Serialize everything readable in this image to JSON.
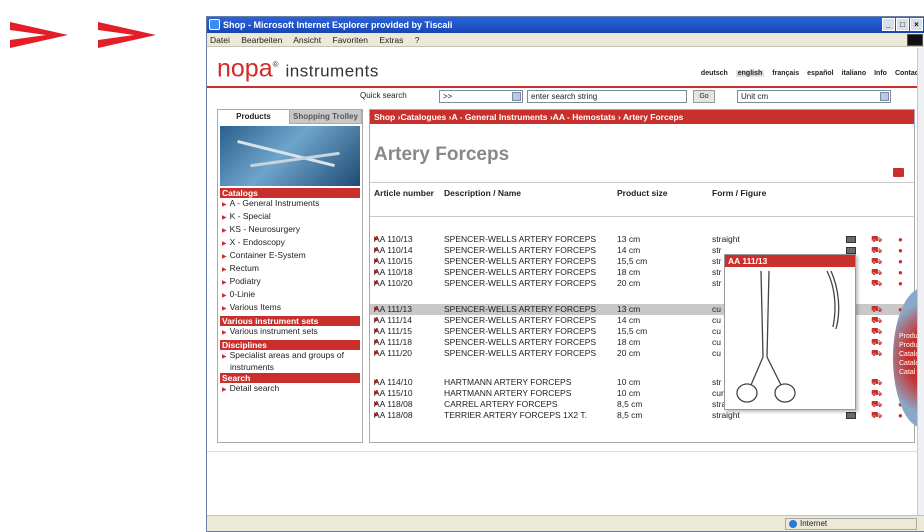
{
  "window": {
    "title": "Shop - Microsoft Internet Explorer provided by Tiscali",
    "controls": [
      "_",
      "□",
      "×"
    ]
  },
  "menubar": [
    "Datei",
    "Bearbeiten",
    "Ansicht",
    "Favoriten",
    "Extras",
    "?"
  ],
  "logo": {
    "brand": "nopa",
    "mark": "®",
    "sub": "instruments"
  },
  "languages": [
    "deutsch",
    "english",
    "français",
    "español",
    "italiano",
    "Info",
    "Contact"
  ],
  "active_language": "english",
  "search": {
    "label": "Quick search",
    "select": ">>",
    "input_value": "enter search string",
    "go": "Go",
    "unit": "Unit cm"
  },
  "sidebar": {
    "tabs": [
      "Products",
      "Shopping Trolley"
    ],
    "sections": [
      {
        "title": "Catalogs",
        "items": [
          "A - General Instruments",
          "K - Special",
          "KS - Neurosurgery",
          "X - Endoscopy",
          "Container E-System",
          "Rectum",
          "Podiatry",
          "0-Linie",
          "Various Items"
        ]
      },
      {
        "title": "Various instrument sets",
        "items": [
          "Various instrument sets"
        ]
      },
      {
        "title": "Disciplines",
        "items": [
          "Specialist areas and groups of instruments"
        ]
      },
      {
        "title": "Search",
        "items": [
          "Detail search"
        ]
      }
    ]
  },
  "breadcrumb": "Shop ›Catalogues ›A - General Instruments ›AA - Hemostats › Artery Forceps",
  "page_title": "Artery Forceps",
  "columns": {
    "article": "Article number",
    "desc": "Description / Name",
    "size": "Product size",
    "form": "Form / Figure"
  },
  "products": [
    {
      "article": "AA 110/13",
      "desc": "SPENCER-WELLS ARTERY FORCEPS",
      "size": "13 cm",
      "form": "straight"
    },
    {
      "article": "AA 110/14",
      "desc": "SPENCER-WELLS ARTERY FORCEPS",
      "size": "14 cm",
      "form": "str"
    },
    {
      "article": "AA 110/15",
      "desc": "SPENCER-WELLS ARTERY FORCEPS",
      "size": "15,5 cm",
      "form": "str"
    },
    {
      "article": "AA 110/18",
      "desc": "SPENCER-WELLS ARTERY FORCEPS",
      "size": "18 cm",
      "form": "str"
    },
    {
      "article": "AA 110/20",
      "desc": "SPENCER-WELLS ARTERY FORCEPS",
      "size": "20 cm",
      "form": "str"
    },
    {
      "article": "AA 111/13",
      "desc": "SPENCER-WELLS ARTERY FORCEPS",
      "size": "13 cm",
      "form": "cu"
    },
    {
      "article": "AA 111/14",
      "desc": "SPENCER-WELLS ARTERY FORCEPS",
      "size": "14 cm",
      "form": "cu"
    },
    {
      "article": "AA 111/15",
      "desc": "SPENCER-WELLS ARTERY FORCEPS",
      "size": "15,5 cm",
      "form": "cu"
    },
    {
      "article": "AA 111/18",
      "desc": "SPENCER-WELLS ARTERY FORCEPS",
      "size": "18 cm",
      "form": "cu"
    },
    {
      "article": "AA 111/20",
      "desc": "SPENCER-WELLS ARTERY FORCEPS",
      "size": "20 cm",
      "form": "cu"
    },
    {
      "article": "AA 114/10",
      "desc": "HARTMANN ARTERY FORCEPS",
      "size": "10 cm",
      "form": "str"
    },
    {
      "article": "AA 115/10",
      "desc": "HARTMANN ARTERY FORCEPS",
      "size": "10 cm",
      "form": "curved"
    },
    {
      "article": "AA 118/08",
      "desc": "CARREL ARTERY FORCEPS",
      "size": "8,5 cm",
      "form": "straight"
    },
    {
      "article": "AA 118/08",
      "desc": "TERRIER ARTERY FORCEPS 1X2 T.",
      "size": "8,5 cm",
      "form": "straight"
    }
  ],
  "popup": {
    "title": "AA 111/13"
  },
  "right_deco": [
    "Produkt",
    "Produc",
    "Catalo",
    "Catalo",
    "Catal"
  ],
  "statusbar": {
    "zone": "Internet"
  },
  "colors": {
    "brand_red": "#c9302c",
    "ie_blue": "#1f56c8"
  }
}
